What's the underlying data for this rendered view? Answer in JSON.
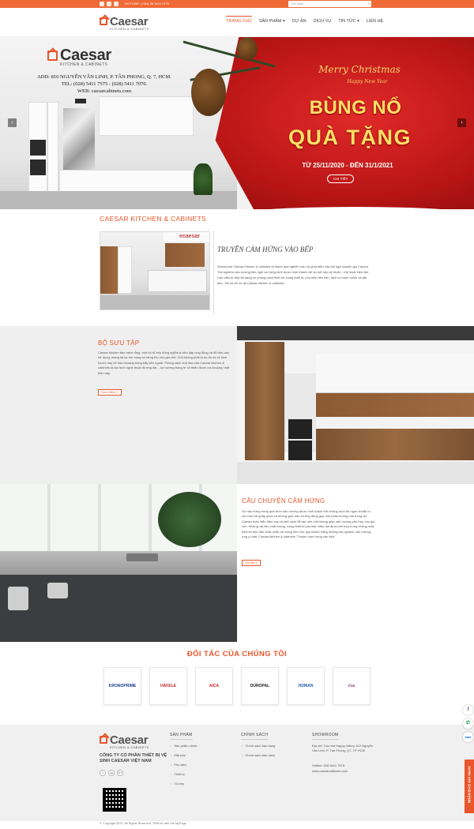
{
  "topbar": {
    "hotline": "HOTLINE: (+84) 28 54117075",
    "search_placeholder": "Tìm kiếm..."
  },
  "brand": {
    "name": "Caesar",
    "tagline": "KITCHEN & CABINETS"
  },
  "nav": {
    "items": [
      "TRANG CHỦ",
      "SẢN PHẨM ▾",
      "DỰ ÁN",
      "DỊCH VỤ",
      "TIN TỨC ▾",
      "LIÊN HỆ"
    ]
  },
  "banner": {
    "addr1": "ADD: 810 NGUYỄN VĂN LINH, P. TÂN PHONG, Q. 7, HCM.",
    "addr2": "TEL: (028) 5411 7575 - (028) 5411 7070.",
    "addr3": "WEB: caesarcabinets.com",
    "xmas": "Merry Christmas",
    "xmas_sub": "Happy New Year",
    "headline1": "BÙNG NỔ",
    "headline2": "QUÀ TẶNG",
    "date": "TỪ 25/11/2020 - ĐẾN 31/1/2021",
    "cta": "CHI TIẾT",
    "prev": "‹",
    "next": "›"
  },
  "intro": {
    "title": "CAESAR KITCHEN & CABINETS",
    "heading": "TRUYỀN CẢM HỨNG VÀO BẾP",
    "text": "Showroom Caesar Kitchen & cabinets là thành quả nghiên cứu và phát triển của đội ngũ chuyên gia Caesar. Trải nghiệm nấu nướng tiện nghi và hứng khởi được hình thành bởi sự kết hợp kỹ thuật – mỹ thuật hiện đại. Các mẫu tủ bếp đa dạng về phong cách thiết kế, trang thiết bị, phụ kiện tiên tiến, dịch vụ hoàn chỉnh và tận tâm. Tất cả chỉ có tại Caesar kitchen & cabinets."
  },
  "collection": {
    "title": "BỘ SƯU TẬP",
    "text": "Caesar kitchen tâm niệm rằng, một bộ tủ bếp đúng nghĩa là việc đáp ứng đúng và đủ nhu cầu sử dụng, mang lại sự êm cùng và hứng thú cho gia chủ. Chủ không phải là sự đồ sộ về kích thước hay vẻ hào nhoáng bóng bẩy bên ngoài. Phong cách chủ đạo của Caesar kitchen & cabinets là tao hình nghệ thuật đương đại – sự hướng trang trí tối thiểu được ưa chuộng nhất hiện nay.",
    "button": "Xem thêm »"
  },
  "story": {
    "title": "CÂU CHUYỆN CẢM HỨNG",
    "text": "Sự háo hứng trong quá trình nấu nướng được hình thành bởi những món ăn ngon chuẩn bị cho bữa tối quây quần và không gian nấu nướng đồng góp một phần không nhỏ trong đó. Caesar thấu hiểu điều này và biết cách để tạo nên một không gian nấu nướng phù hợp cho gia chủ. Những vật liệu chất lượng, trang thiết bị phụ kiện hiện đại được kết hợp trong những mẫu thiết kế độc đáo chắc chắn sẽ mang đến cho quý khách hàng những trải nghiệm nấu nướng ưng ý nhất. Caesar kitchen & cabinets \"Truyền cảm hứng vào bếp\".",
    "button": "Chi tiết »"
  },
  "partners": {
    "title": "ĐỐI TÁC CỦA CHÚNG TÔI",
    "items": [
      "KRONOPRIME",
      "HÄFELE",
      "AICA",
      "DUROPAL",
      "HOMAN",
      "Fim"
    ]
  },
  "footer": {
    "company": "CÔNG TY CỔ PHẦN THIẾT BỊ VỆ SINH CAESAR VIỆT NAM",
    "col1_title": "SẢN PHẨM",
    "col1_links": [
      "Sản phẩm chính",
      "Mặt bếp",
      "Phụ kiện",
      "Thiết bị",
      "Tủ bếp"
    ],
    "col2_title": "CHÍNH SÁCH",
    "col2_links": [
      "Chính sách bảo hàng",
      "Chính sách bảo hành"
    ],
    "col3_title": "SHOWROOM",
    "showroom_addr": "Địa chỉ: Tòa nhà Happy Valley, 810 Nguyễn Văn Linh, P. Tân Phong, Q7, TP HCM",
    "showroom_phone": "Hotline: 028 5411 7575",
    "showroom_web": "www.caesarcabinets.com",
    "social": [
      "f",
      "ig",
      "G+"
    ],
    "copyright": "© Copyright 2020. All Rights Reserved. Thiết kế web bởi MyPage"
  },
  "floating": {
    "promo": "NHẬN BÁO GIÁ NGAY",
    "icons": [
      "f",
      "✆",
      "Zalo"
    ]
  }
}
